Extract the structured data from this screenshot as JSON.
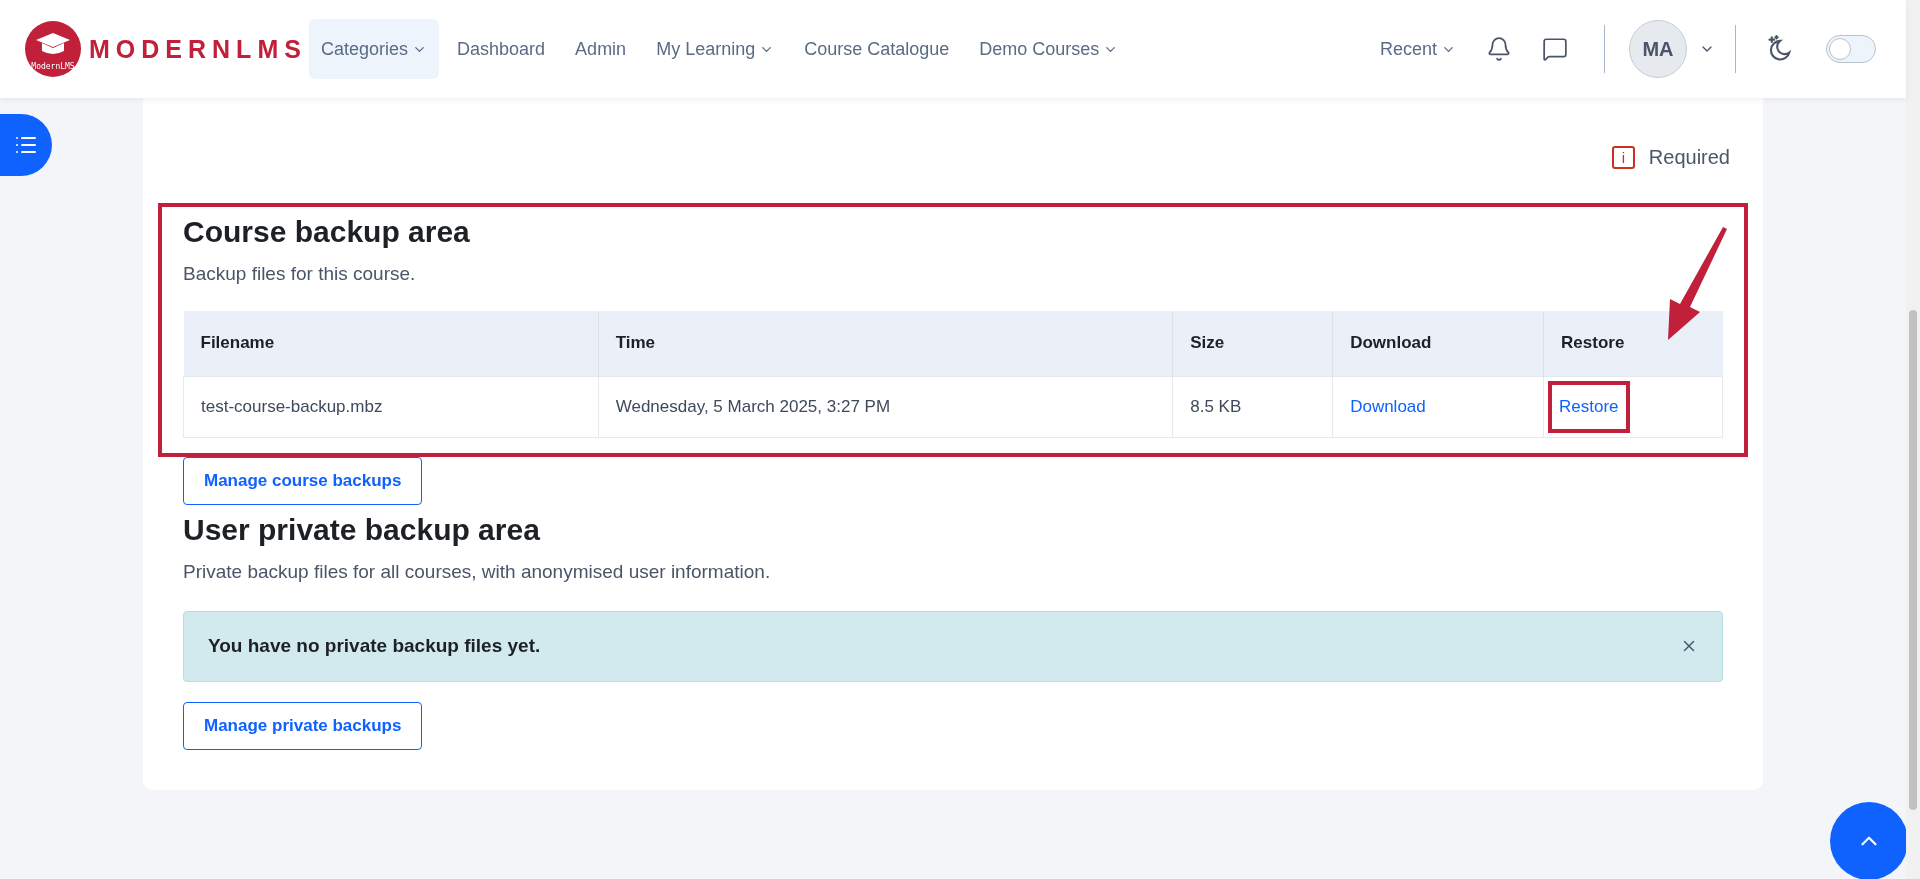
{
  "header": {
    "logo": {
      "wordmark": "MODERNLMS",
      "badge_text": "ModernLMS"
    },
    "nav": [
      {
        "label": "Categories",
        "dropdown": true,
        "selected": true
      },
      {
        "label": "Dashboard",
        "dropdown": false,
        "selected": false
      },
      {
        "label": "Admin",
        "dropdown": false,
        "selected": false
      },
      {
        "label": "My Learning",
        "dropdown": true,
        "selected": false
      },
      {
        "label": "Course Catalogue",
        "dropdown": false,
        "selected": false
      },
      {
        "label": "Demo Courses",
        "dropdown": true,
        "selected": false
      }
    ],
    "recent": "Recent",
    "avatar": "MA",
    "dark_mode": {
      "on": false
    }
  },
  "required_icon": "i",
  "required_label": "Required",
  "course_backup": {
    "title": "Course backup area",
    "description": "Backup files for this course.",
    "table": {
      "columns": [
        "Filename",
        "Time",
        "Size",
        "Download",
        "Restore"
      ],
      "rows": [
        {
          "filename": "test-course-backup.mbz",
          "time": "Wednesday, 5 March 2025, 3:27 PM",
          "size": "8.5 KB",
          "download": "Download",
          "restore": "Restore"
        }
      ]
    },
    "button": "Manage course backups"
  },
  "private_backup": {
    "title": "User private backup area",
    "description": "Private backup files for all courses, with anonymised user information.",
    "alert": "You have no private backup files yet.",
    "button": "Manage private backups"
  }
}
